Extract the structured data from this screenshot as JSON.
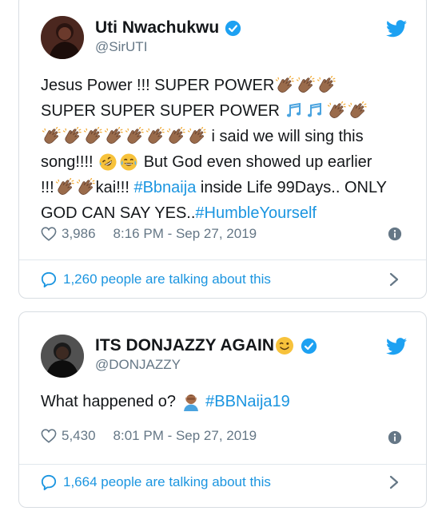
{
  "tweets": [
    {
      "author_name": "Uti Nwachukwu",
      "handle": "@SirUTI",
      "body_lines": [
        [
          {
            "t": "text",
            "v": "Jesus Power !!! SUPER POWER"
          },
          {
            "t": "emoji",
            "v": "clap"
          },
          {
            "t": "emoji",
            "v": "clap"
          },
          {
            "t": "emoji",
            "v": "clap"
          }
        ],
        [
          {
            "t": "text",
            "v": "SUPER SUPER SUPER POWER "
          },
          {
            "t": "emoji",
            "v": "notes"
          },
          {
            "t": "emoji",
            "v": "notes"
          },
          {
            "t": "emoji",
            "v": "clap"
          },
          {
            "t": "emoji",
            "v": "clap"
          }
        ],
        [
          {
            "t": "emoji",
            "v": "clap"
          },
          {
            "t": "emoji",
            "v": "clap"
          },
          {
            "t": "emoji",
            "v": "clap"
          },
          {
            "t": "emoji",
            "v": "clap"
          },
          {
            "t": "emoji",
            "v": "clap"
          },
          {
            "t": "emoji",
            "v": "clap"
          },
          {
            "t": "emoji",
            "v": "clap"
          },
          {
            "t": "emoji",
            "v": "clap"
          },
          {
            "t": "text",
            "v": " i said we will sing this"
          }
        ],
        [
          {
            "t": "text",
            "v": "song!!!! "
          },
          {
            "t": "emoji",
            "v": "rofl"
          },
          {
            "t": "emoji",
            "v": "joy"
          },
          {
            "t": "text",
            "v": " But God even showed up earlier"
          }
        ],
        [
          {
            "t": "text",
            "v": "!!!"
          },
          {
            "t": "emoji",
            "v": "clap"
          },
          {
            "t": "emoji",
            "v": "clap"
          },
          {
            "t": "text",
            "v": "kai!!! "
          },
          {
            "t": "link",
            "v": "#Bbnaija"
          },
          {
            "t": "text",
            "v": " inside Life 99Days.. ONLY"
          }
        ],
        [
          {
            "t": "text",
            "v": "GOD CAN SAY YES.."
          },
          {
            "t": "link",
            "v": "#HumbleYourself"
          }
        ]
      ],
      "likes": "3,986",
      "timestamp": "8:16 PM - Sep 27, 2019",
      "talking": "1,260 people are talking about this"
    },
    {
      "author_name": "ITS DONJAZZY AGAIN",
      "handle": "@DONJAZZY",
      "body_lines": [
        [
          {
            "t": "text",
            "v": "What happened o? "
          },
          {
            "t": "emoji",
            "v": "facepalm"
          },
          {
            "t": "text",
            "v": " "
          },
          {
            "t": "link",
            "v": "#BBNaija19"
          }
        ]
      ],
      "likes": "5,430",
      "timestamp": "8:01 PM - Sep 27, 2019",
      "talking": "1,664 people are talking about this"
    }
  ],
  "icons": {
    "verified": "verified-badge-icon",
    "twitter": "twitter-bird-icon",
    "like": "heart-icon",
    "info": "info-icon",
    "conversation": "speech-bubble-icon",
    "open": "chevron-right-icon"
  },
  "colors": {
    "brand_blue": "#1da1f2",
    "link_blue": "#1b95e0",
    "muted_gray": "#657786",
    "text": "#14171a",
    "border": "#d8dde2"
  }
}
